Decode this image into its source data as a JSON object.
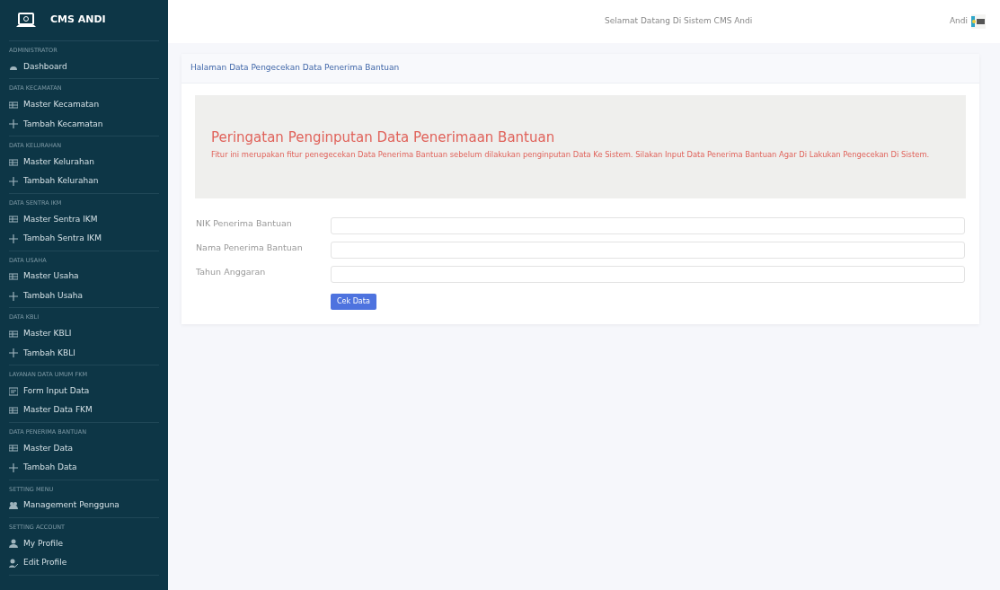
{
  "brand": {
    "title": "CMS ANDI"
  },
  "sidebar": {
    "sections": [
      {
        "heading": "ADMINISTRATOR",
        "items": [
          {
            "label": "Dashboard",
            "kind": "gauge"
          }
        ]
      },
      {
        "heading": "DATA KECAMATAN",
        "items": [
          {
            "label": "Master Kecamatan",
            "kind": "table"
          },
          {
            "label": "Tambah Kecamatan",
            "kind": "add"
          }
        ]
      },
      {
        "heading": "DATA KELURAHAN",
        "items": [
          {
            "label": "Master Kelurahan",
            "kind": "table"
          },
          {
            "label": "Tambah Kelurahan",
            "kind": "add"
          }
        ]
      },
      {
        "heading": "DATA SENTRA IKM",
        "items": [
          {
            "label": "Master Sentra IKM",
            "kind": "table"
          },
          {
            "label": "Tambah Sentra IKM",
            "kind": "add"
          }
        ]
      },
      {
        "heading": "DATA USAHA",
        "items": [
          {
            "label": "Master Usaha",
            "kind": "table"
          },
          {
            "label": "Tambah Usaha",
            "kind": "add"
          }
        ]
      },
      {
        "heading": "DATA KBLI",
        "items": [
          {
            "label": "Master KBLI",
            "kind": "table"
          },
          {
            "label": "Tambah KBLI",
            "kind": "add"
          }
        ]
      },
      {
        "heading": "LAYANAN DATA UMUM FKM",
        "items": [
          {
            "label": "Form Input Data",
            "kind": "form"
          },
          {
            "label": "Master Data FKM",
            "kind": "table"
          }
        ]
      },
      {
        "heading": "DATA PENERIMA BANTUAN",
        "items": [
          {
            "label": "Master Data",
            "kind": "table"
          },
          {
            "label": "Tambah Data",
            "kind": "add"
          }
        ]
      },
      {
        "heading": "SETTING MENU",
        "items": [
          {
            "label": "Management Pengguna",
            "kind": "users"
          }
        ]
      },
      {
        "heading": "SETTING ACCOUNT",
        "items": [
          {
            "label": "My Profile",
            "kind": "user"
          },
          {
            "label": "Edit Profile",
            "kind": "user-edit"
          }
        ]
      }
    ]
  },
  "topbar": {
    "welcome": "Selamat Datang Di Sistem CMS Andi",
    "user": "Andi"
  },
  "card": {
    "header": "Halaman Data Pengecekan Data Penerima Bantuan",
    "alert": {
      "title": "Peringatan Penginputan Data Penerimaan Bantuan",
      "text": "Fitur ini merupakan fitur penegecekan Data Penerima Bantuan sebelum dilakukan penginputan Data Ke Sistem. Silakan Input Data Penerima Bantuan Agar Di Lakukan Pengecekan Di Sistem."
    },
    "fields": [
      {
        "label": "NIK Penerima Bantuan"
      },
      {
        "label": "Nama Penerima Bantuan"
      },
      {
        "label": "Tahun Anggaran"
      }
    ],
    "button": "Cek Data"
  }
}
